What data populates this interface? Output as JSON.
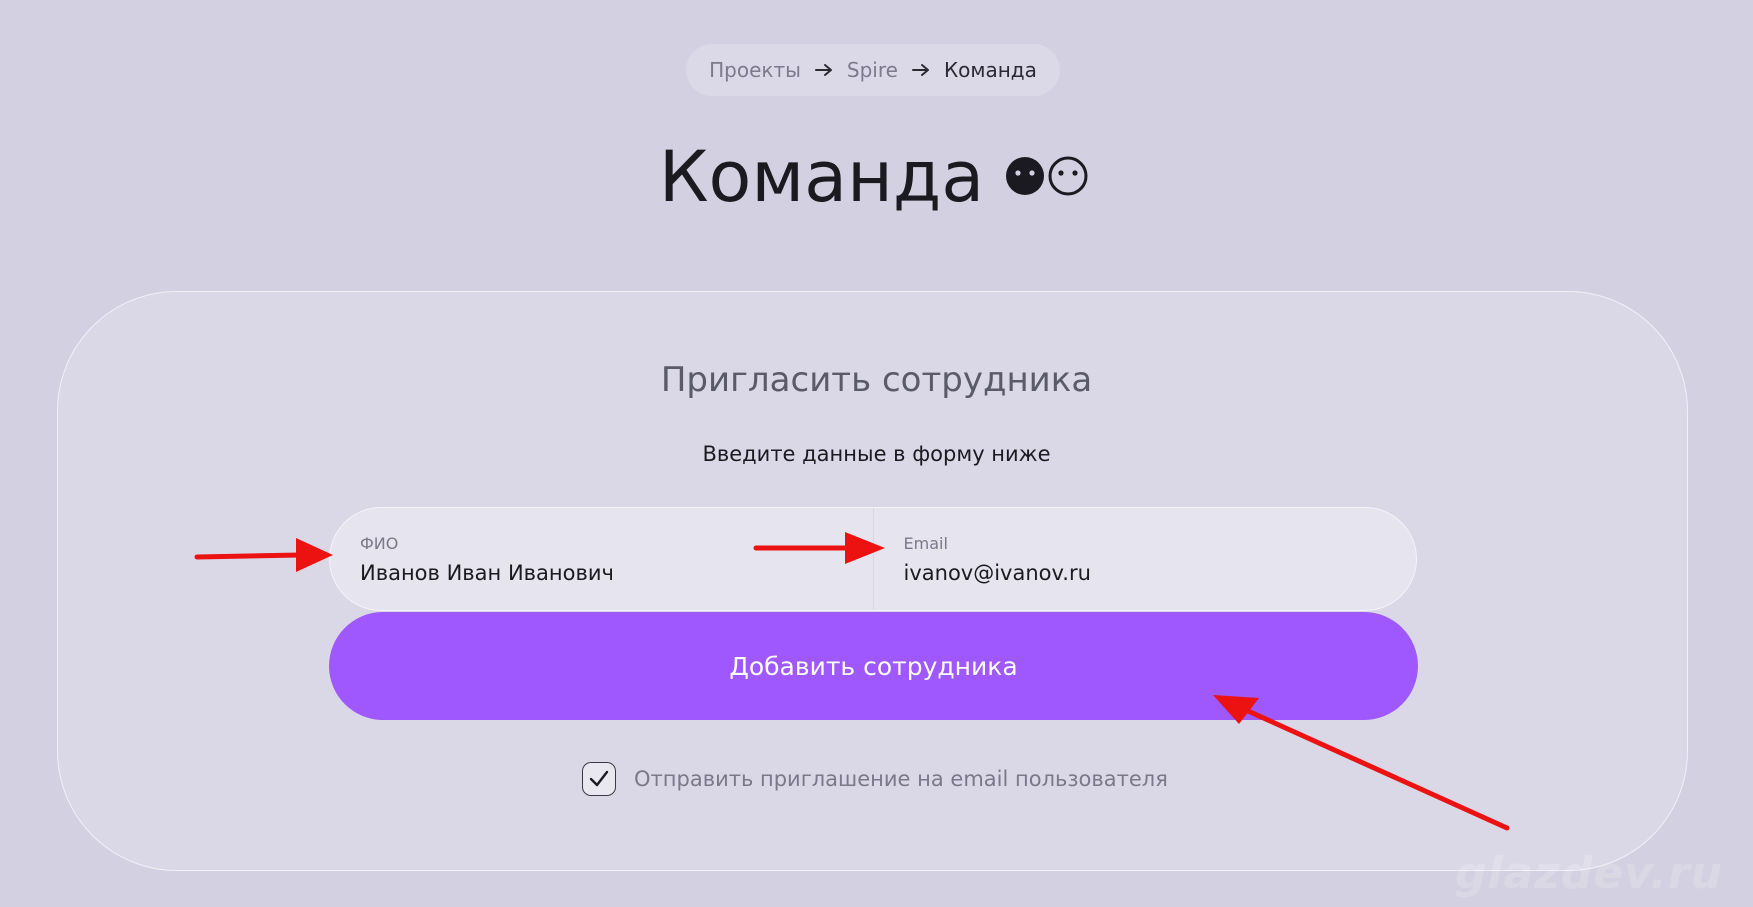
{
  "breadcrumb": {
    "items": [
      {
        "label": "Проекты"
      },
      {
        "label": "Spire"
      },
      {
        "label": "Команда"
      }
    ]
  },
  "page": {
    "title": "Команда",
    "title_icon": "two-faces-icon"
  },
  "invite_form": {
    "title": "Пригласить сотрудника",
    "subtitle": "Введите данные в форму ниже",
    "fields": {
      "name": {
        "label": "ФИО",
        "value": "Иванов Иван Иванович"
      },
      "email": {
        "label": "Email",
        "value": "ivanov@ivanov.ru"
      }
    },
    "submit_label": "Добавить сотрудника",
    "send_invite": {
      "checked": true,
      "label": "Отправить приглашение на email пользователя"
    }
  },
  "watermark": "glazdev.ru",
  "colors": {
    "background": "#d3d0e1",
    "card": "#dad8e7",
    "accent": "#9f58fd",
    "annotation_arrow": "#ec1212"
  }
}
